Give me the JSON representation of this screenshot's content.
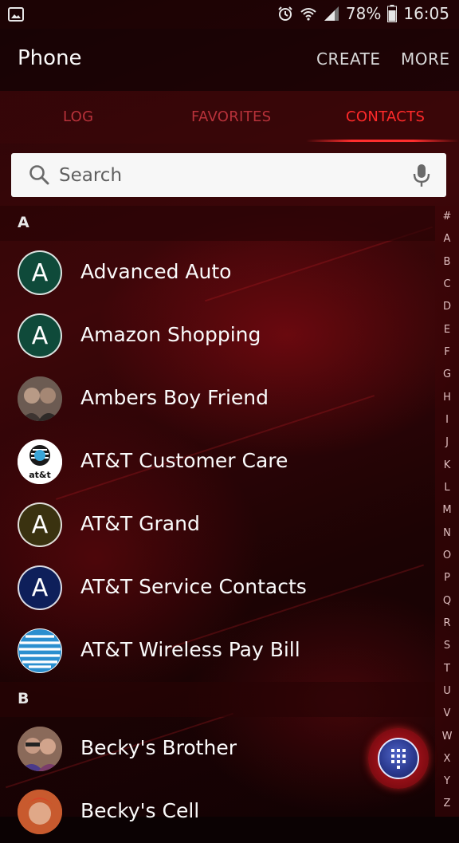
{
  "status_bar": {
    "battery": "78%",
    "time": "16:05"
  },
  "app_bar": {
    "title": "Phone",
    "create_label": "CREATE",
    "more_label": "MORE"
  },
  "tabs": [
    {
      "label": "LOG"
    },
    {
      "label": "FAVORITES"
    },
    {
      "label": "CONTACTS",
      "active": true
    }
  ],
  "search": {
    "placeholder": "Search"
  },
  "sections": [
    {
      "letter": "A",
      "contacts": [
        {
          "name": "Advanced Auto",
          "avatar_letter": "A",
          "avatar_color": "#0f4a3a"
        },
        {
          "name": "Amazon Shopping",
          "avatar_letter": "A",
          "avatar_color": "#0f4a3a"
        },
        {
          "name": "Ambers Boy Friend",
          "avatar_type": "photo"
        },
        {
          "name": "AT&T Customer Care",
          "avatar_type": "logo",
          "avatar_text": "at&t"
        },
        {
          "name": "AT&T Grand",
          "avatar_letter": "A",
          "avatar_color": "#3a3210"
        },
        {
          "name": "AT&T Service Contacts",
          "avatar_letter": "A",
          "avatar_color": "#0e1f5a"
        },
        {
          "name": "AT&T Wireless Pay Bill",
          "avatar_type": "globe-logo"
        }
      ]
    },
    {
      "letter": "B",
      "contacts": [
        {
          "name": "Becky's Brother",
          "avatar_type": "photo"
        },
        {
          "name": "Becky's Cell",
          "avatar_type": "photo"
        }
      ]
    }
  ],
  "alpha_index": [
    "#",
    "A",
    "B",
    "C",
    "D",
    "E",
    "F",
    "G",
    "H",
    "I",
    "J",
    "K",
    "L",
    "M",
    "N",
    "O",
    "P",
    "Q",
    "R",
    "S",
    "T",
    "U",
    "V",
    "W",
    "X",
    "Y",
    "Z"
  ],
  "colors": {
    "accent_red": "#ff2a2a",
    "tab_inactive": "#b8323a"
  },
  "fab": {
    "icon": "dialpad-icon"
  }
}
